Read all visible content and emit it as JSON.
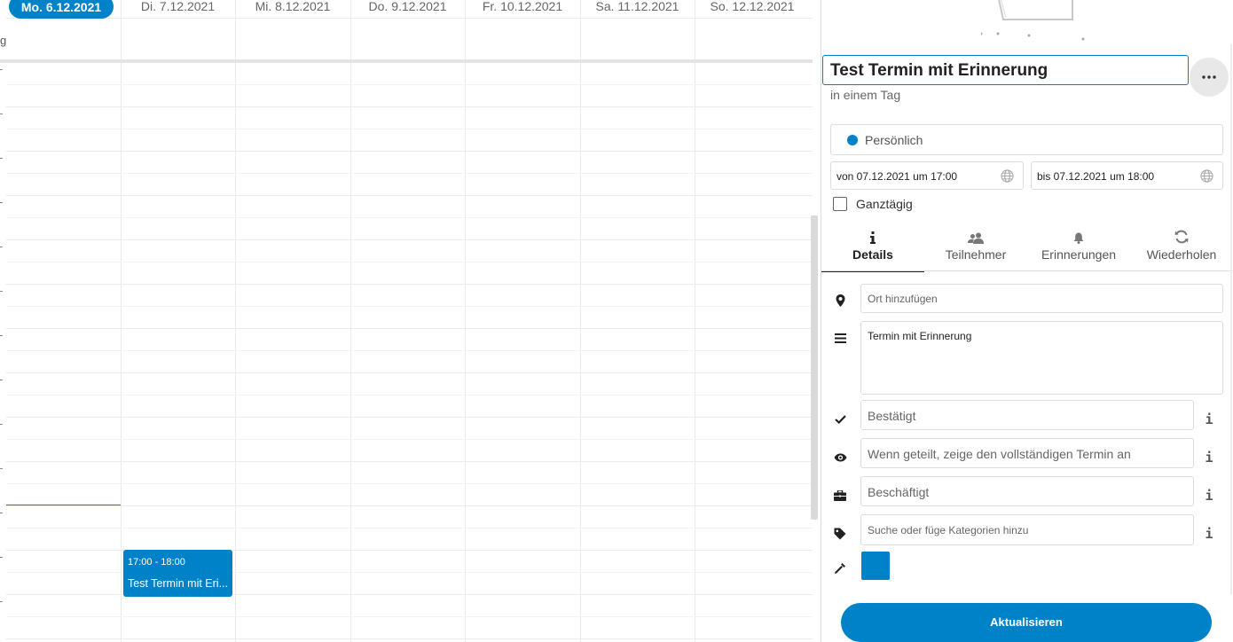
{
  "calendar": {
    "allday_label": "g",
    "days": [
      {
        "label": "Mo. 6.12.2021",
        "today": true
      },
      {
        "label": "Di. 7.12.2021",
        "today": false
      },
      {
        "label": "Mi. 8.12.2021",
        "today": false
      },
      {
        "label": "Do. 9.12.2021",
        "today": false
      },
      {
        "label": "Fr. 10.12.2021",
        "today": false
      },
      {
        "label": "Sa. 11.12.2021",
        "today": false
      },
      {
        "label": "So. 12.12.2021",
        "today": false
      }
    ],
    "event": {
      "time": "17:00 - 18:00",
      "title": "Test Termin mit Eri...",
      "color": "#0082c9"
    }
  },
  "sidebar": {
    "title": "Test Termin mit Erinnerung",
    "more_icon": "more-icon",
    "subtitle": "in einem Tag",
    "calendar_name": "Persönlich",
    "calendar_color": "#0082c9",
    "start": "von 07.12.2021 um 17:00",
    "end": "bis 07.12.2021 um 18:00",
    "allday_label": "Ganztägig",
    "tabs": [
      {
        "label": "Details",
        "icon": "info-icon",
        "active": true
      },
      {
        "label": "Teilnehmer",
        "icon": "people-icon",
        "active": false
      },
      {
        "label": "Erinnerungen",
        "icon": "bell-icon",
        "active": false
      },
      {
        "label": "Wiederholen",
        "icon": "repeat-icon",
        "active": false
      }
    ],
    "location_placeholder": "Ort hinzufügen",
    "description": "Termin mit Erinnerung",
    "status": "Bestätigt",
    "visibility": "Wenn geteilt, zeige den vollständigen Termin an",
    "busy": "Beschäftigt",
    "categories_placeholder": "Suche oder füge Kategorien hinzu",
    "info_glyph": "i",
    "event_color": "#0082c9",
    "update_button": "Aktualisieren"
  }
}
